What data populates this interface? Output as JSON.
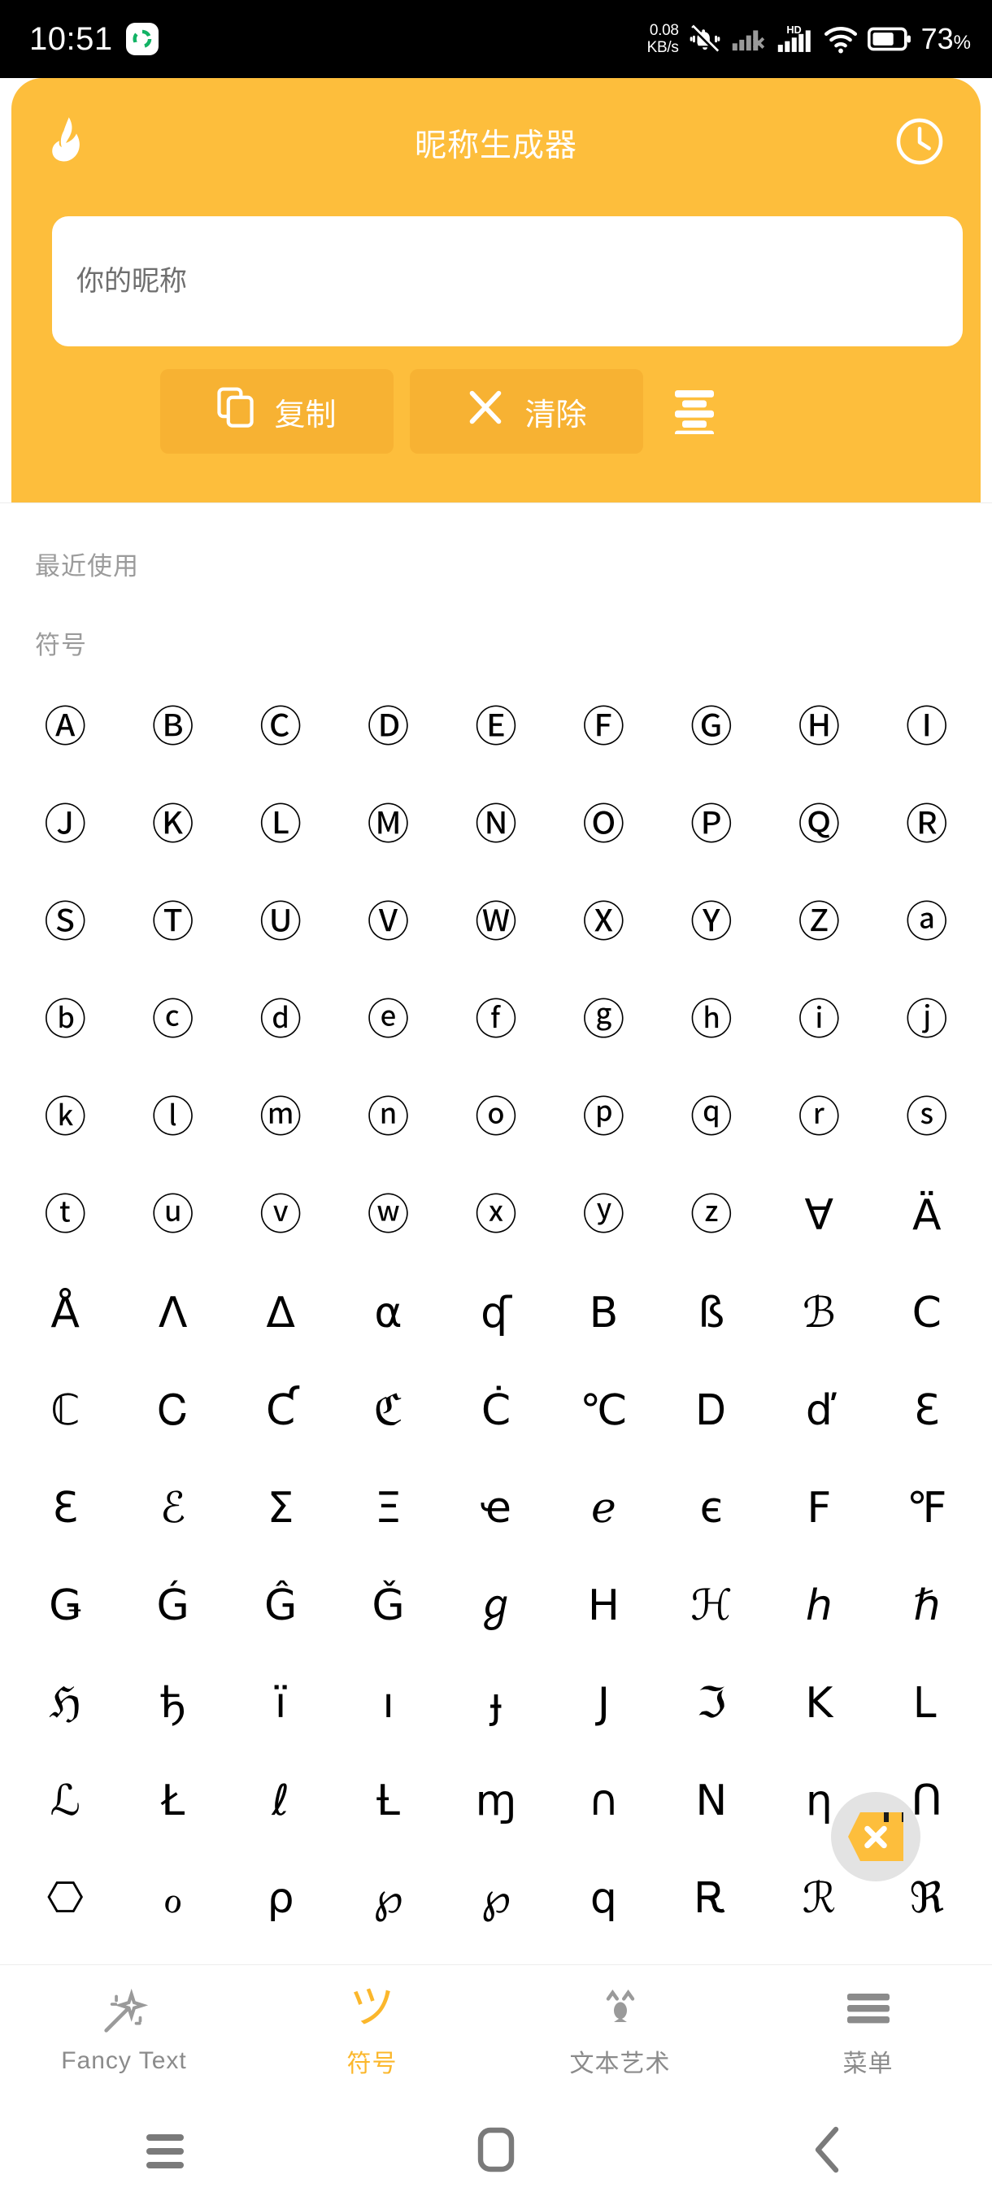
{
  "statusbar": {
    "clock": "10:51",
    "green_icon": "recycle-sync-icon",
    "net_speed_value": "0.08",
    "net_speed_unit": "KB/s",
    "icons": [
      "mute-bell-icon",
      "no-sim-signal-icon",
      "hd-signal-icon",
      "wifi-icon",
      "battery-icon"
    ],
    "battery_percent": "73",
    "battery_percent_symbol": "%"
  },
  "header": {
    "brand_icon": "flame-icon",
    "title": "昵称生成器",
    "history_icon": "clock-history-icon",
    "accent_color": "#FDBE3C",
    "button_color": "#F7B233"
  },
  "input": {
    "placeholder": "你的昵称",
    "value": ""
  },
  "toolbar": {
    "copy_label": "复制",
    "copy_icon": "copy-icon",
    "clear_label": "清除",
    "clear_icon": "close-x-icon",
    "list_icon": "list-lines-icon"
  },
  "sections": {
    "recent_label": "最近使用",
    "symbols_label": "符号"
  },
  "symbols": [
    "Ⓐ",
    "Ⓑ",
    "Ⓒ",
    "Ⓓ",
    "Ⓔ",
    "Ⓕ",
    "Ⓖ",
    "Ⓗ",
    "Ⓘ",
    "Ⓙ",
    "Ⓚ",
    "Ⓛ",
    "Ⓜ",
    "Ⓝ",
    "Ⓞ",
    "Ⓟ",
    "Ⓠ",
    "Ⓡ",
    "Ⓢ",
    "Ⓣ",
    "Ⓤ",
    "Ⓥ",
    "Ⓦ",
    "Ⓧ",
    "Ⓨ",
    "Ⓩ",
    "ⓐ",
    "ⓑ",
    "ⓒ",
    "ⓓ",
    "ⓔ",
    "ⓕ",
    "ⓖ",
    "ⓗ",
    "ⓘ",
    "ⓙ",
    "ⓚ",
    "ⓛ",
    "ⓜ",
    "ⓝ",
    "ⓞ",
    "ⓟ",
    "ⓠ",
    "ⓡ",
    "ⓢ",
    "ⓣ",
    "ⓤ",
    "ⓥ",
    "ⓦ",
    "ⓧ",
    "ⓨ",
    "ⓩ",
    "Ɐ",
    "Ä",
    "Å",
    "Ʌ",
    "Δ",
    "α",
    "ʠ",
    "Β",
    "ß",
    "ℬ",
    "Ⅽ",
    "ℂ",
    "Ꮯ",
    "Ƈ",
    "ℭ",
    "Ċ",
    "℃",
    "Ꭰ",
    "ď",
    "Ɛ",
    "Ԑ",
    "ℰ",
    "Σ",
    "Ξ",
    "ҽ",
    "ℯ",
    "є",
    "Ϝ",
    "℉",
    "Ǥ",
    "Ǵ",
    "Ĝ",
    "Ǧ",
    "ℊ",
    "Η",
    "ℋ",
    "ℎ",
    "ℏ",
    "ℌ",
    "ђ",
    "ï",
    "ı",
    "ɟ",
    "Ј",
    "ℑ",
    "Κ",
    "Ꮮ",
    "ℒ",
    "Ł",
    "ℓ",
    "Ƚ",
    "ɱ",
    "∩",
    "Ν",
    "ƞ",
    "Ո",
    "⎔",
    "ℴ",
    "ρ",
    "℘",
    "℘",
    "ԛ",
    "Ꭱ",
    "ℛ",
    "ℜ"
  ],
  "fab": {
    "name": "floating-close-widget",
    "icon": "hex-close-icon",
    "color": "#FDBE3C"
  },
  "tabbar": {
    "tabs": [
      {
        "label": "Fancy Text",
        "icon": "magic-wand-icon",
        "active": false
      },
      {
        "label": "符号",
        "icon": "tsu-smiley-icon",
        "glyph": "ツ",
        "active": true
      },
      {
        "label": "文本艺术",
        "icon": "kaomoji-face-icon",
        "active": false
      },
      {
        "label": "菜单",
        "icon": "hamburger-menu-icon",
        "active": false
      }
    ],
    "active_color": "#FBB72C",
    "inactive_color": "#8B8B8B"
  },
  "navbar": {
    "recents_icon": "recents-icon",
    "home_icon": "home-square-icon",
    "back_icon": "back-chevron-icon"
  }
}
